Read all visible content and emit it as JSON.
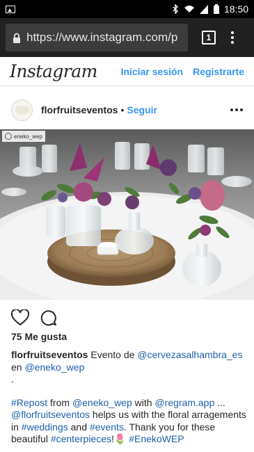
{
  "status_bar": {
    "time": "18:50",
    "icons": [
      "gallery-icon",
      "bluetooth-icon",
      "wifi-icon",
      "signal-icon",
      "battery-icon"
    ]
  },
  "browser": {
    "url": "https://www.instagram.com/p",
    "tab_count": "1"
  },
  "instagram": {
    "logo": "Instagram",
    "login": "Iniciar sesión",
    "signup": "Registrarte"
  },
  "post": {
    "username": "florfruitseventos",
    "separator": "•",
    "follow": "Seguir",
    "watermark": "eneko_wep",
    "likes": "75 Me gusta",
    "caption_user": "florfruitseventos",
    "caption_line1_text": " Evento de ",
    "mention_1": "@cervezasalhambra_es",
    "caption_en": "en ",
    "mention_2": "@eneko_wep",
    "dot_line": ".",
    "hashtag_repost": "#Repost",
    "text_from": " from ",
    "mention_3": "@eneko_wep",
    "text_with": " with ",
    "mention_4": "@regram.app",
    "text_ellipsis": " ...",
    "mention_5": "@florfruitseventos",
    "text_helps": " helps us with the floral arragements in ",
    "hashtag_weddings": "#weddings",
    "text_and": " and ",
    "hashtag_events": "#events",
    "text_thank": ". Thank you for these beautiful ",
    "hashtag_centerpieces": "#centerpieces",
    "text_excl": "!",
    "emoji_tulip": "🌷",
    "hashtag_enekowep": "#EnekoWEP"
  },
  "colors": {
    "link_blue": "#3897f0",
    "caption_link": "#1e5fa8",
    "status_bar_bg": "#000000",
    "browser_bar_bg": "#212121"
  }
}
